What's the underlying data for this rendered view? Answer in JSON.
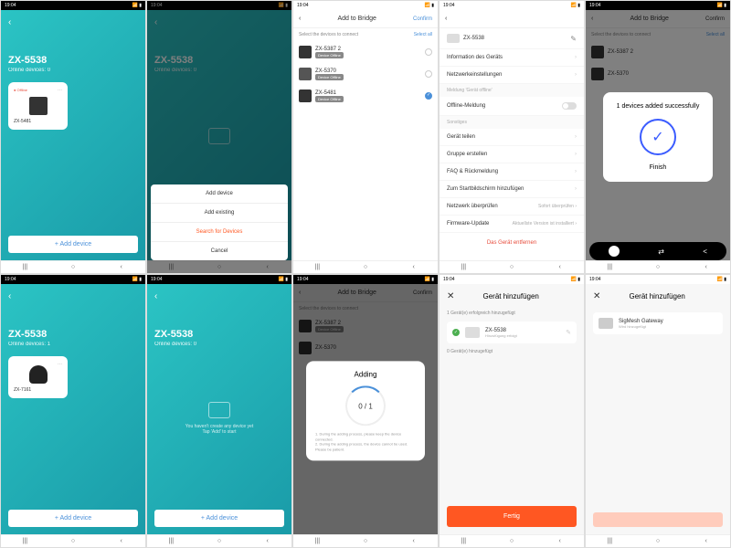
{
  "time": "19:04",
  "battery": "■",
  "hub_name": "ZX-5538",
  "online_0": "Online devices: 0",
  "online_1": "Online devices: 1",
  "offline_label": "Offline",
  "device_5481": "ZX-5481",
  "device_7161": "ZX-7161",
  "add_device": "+  Add device",
  "sheet": {
    "add": "Add device",
    "existing": "Add existing",
    "search": "Search for Devices",
    "cancel": "Cancel"
  },
  "bridge": {
    "title": "Add to Bridge",
    "confirm": "Confirm",
    "select_label": "Select the devices to connect",
    "select_all": "Select all"
  },
  "devices": [
    {
      "name": "ZX-5387 2",
      "status": "Device Offline"
    },
    {
      "name": "ZX-5370",
      "status": "Device Offline"
    },
    {
      "name": "ZX-5481",
      "status": "Device Offline"
    }
  ],
  "settings": {
    "name": "ZX-5538",
    "info": "Information des Geräts",
    "network": "Netzwerkeinstellungen",
    "offline_section": "Meldung 'Gerät offline'",
    "offline_toggle": "Offline-Meldung",
    "other": "Sonstiges",
    "share": "Gerät teilen",
    "group": "Gruppe erstellen",
    "faq": "FAQ & Rückmeldung",
    "home": "Zum Startbildschirm hinzufügen",
    "netcheck": "Netzwerk überprüfen",
    "netcheck_sub": "Sofort überprüfen",
    "firmware": "Firmware-Update",
    "firmware_sub": "Aktuellste Version ist installiert",
    "remove": "Das Gerät entfernen"
  },
  "success": {
    "msg": "1 devices added successfully",
    "finish": "Finish"
  },
  "adding": {
    "title": "Adding",
    "progress": "0 / 1",
    "hint1": "1. During the adding process, please keep the device connected.",
    "hint2": "2. During the adding process, the device cannot be used. Please be patient."
  },
  "empty": "You haven't create any device yet\nTap 'Add' to start",
  "add_de": {
    "title": "Gerät hinzufügen",
    "success_count": "1 Gerät(e) erfolgreich hinzugefügt",
    "fail_count": "0 Gerät(e) hinzugefügt",
    "device": "ZX-5538",
    "status_ok": "Hinzufügung erfolgt",
    "gateway": "SigMesh Gateway",
    "gateway_status": "Wird hinzugefügt",
    "fertig": "Fertig"
  }
}
